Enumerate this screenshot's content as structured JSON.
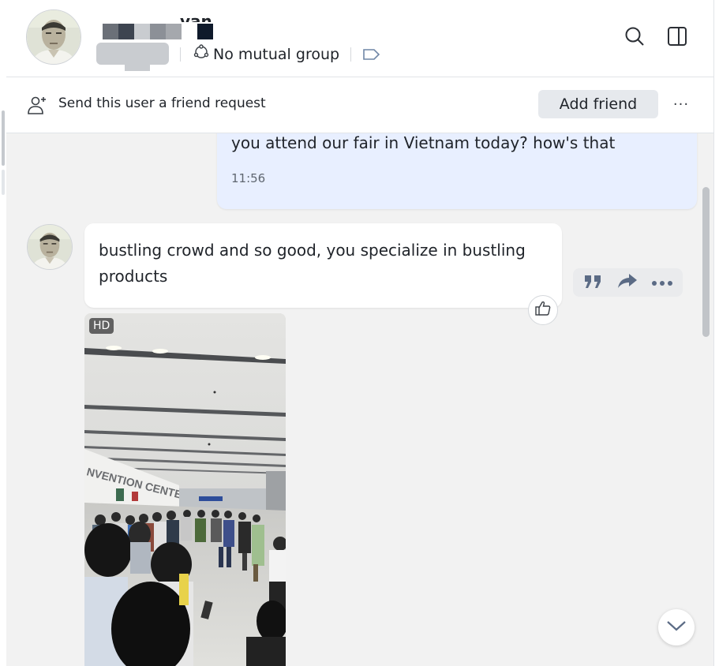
{
  "header": {
    "name_visible_fragment": "van",
    "mutual_group": "No mutual group",
    "redaction_colors": [
      "#3d4450",
      "#1e2733",
      "#8c9097",
      "#c9ccd0",
      "#6b7078",
      "#a5a8ad",
      "#0f1a2b"
    ]
  },
  "friend_bar": {
    "prompt": "Send this user a friend request",
    "add_friend_label": "Add friend",
    "more_label": "···"
  },
  "messages": {
    "outgoing": {
      "text": "you attend our fair in Vietnam today? how's that",
      "time": "11:56"
    },
    "incoming": {
      "text": "bustling crowd and so good, you specialize in bustling products"
    },
    "photo": {
      "badge": "HD",
      "sign_text": "NVENTION CENTER"
    }
  },
  "icons": {
    "search": "search-icon",
    "panel": "side-panel-icon",
    "mutual": "group-icon",
    "tag": "tag-icon",
    "add_user": "add-user-icon",
    "quote": "quote-icon",
    "forward": "forward-icon",
    "more": "more-icon",
    "like": "thumbs-up-icon",
    "scroll_down": "chevron-down-icon"
  },
  "colors": {
    "outgoing_bubble": "#e8efff",
    "chat_background": "#f2f2f2",
    "add_friend_bg": "#e6e9ed",
    "action_icon": "#5b6b85"
  }
}
